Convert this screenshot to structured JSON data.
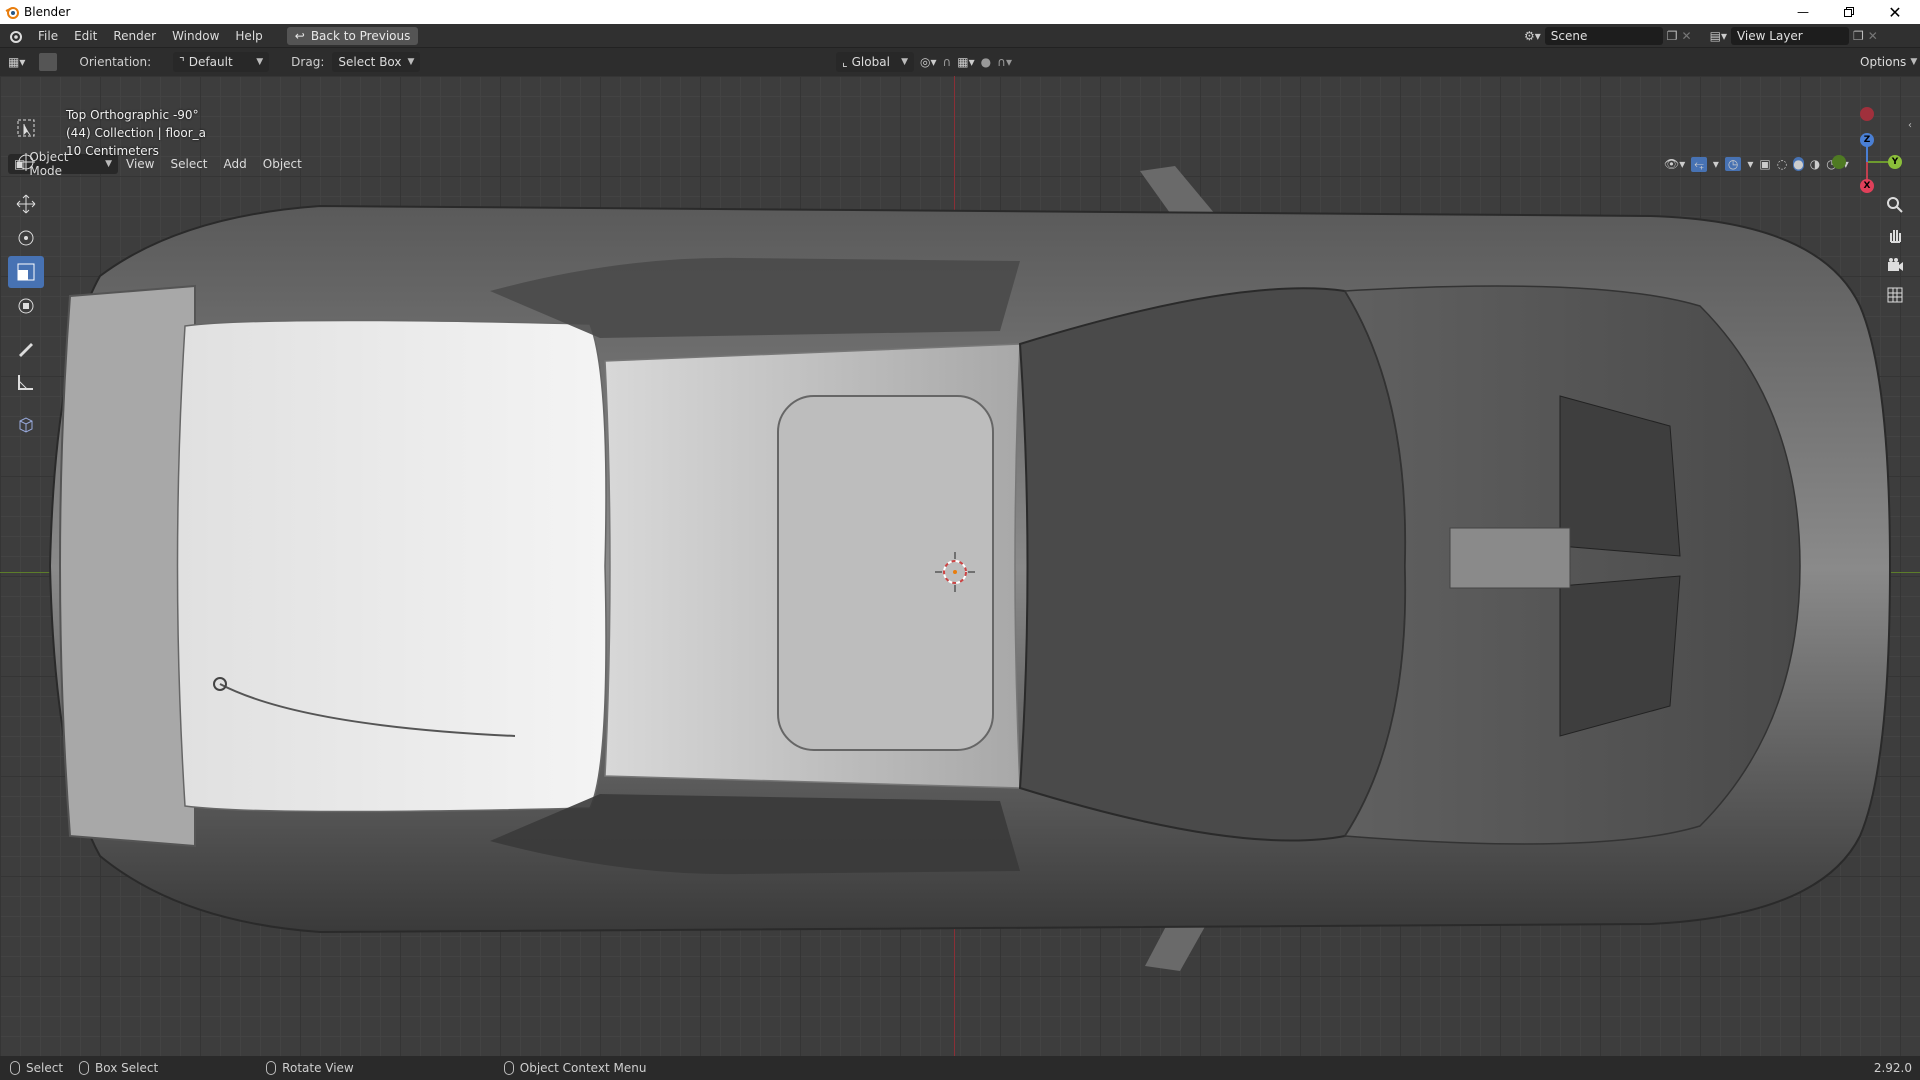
{
  "window": {
    "title": "Blender"
  },
  "menu": {
    "file": "File",
    "edit": "Edit",
    "render": "Render",
    "window": "Window",
    "help": "Help",
    "back_button": "Back to Previous"
  },
  "scene": {
    "scene_name": "Scene",
    "view_layer": "View Layer"
  },
  "tool_header": {
    "orientation_label": "Orientation:",
    "orientation_value": "Default",
    "drag_label": "Drag:",
    "drag_value": "Select Box",
    "transform_orientation": "Global",
    "options": "Options"
  },
  "viewport_header": {
    "mode": "Object Mode",
    "view": "View",
    "select": "Select",
    "add": "Add",
    "object": "Object"
  },
  "viewport_info": {
    "view_name": "Top Orthographic -90°",
    "collection": "(44) Collection | floor_a",
    "scale": "10 Centimeters"
  },
  "gizmo": {
    "x": "X",
    "y": "Y",
    "z": "Z"
  },
  "status": {
    "select": "Select",
    "box_select": "Box Select",
    "rotate_view": "Rotate View",
    "context_menu": "Object Context Menu",
    "version": "2.92.0"
  },
  "colors": {
    "accent": "#4772b3",
    "axis_x": "#5c7d2a",
    "axis_y": "#8a2f36"
  }
}
